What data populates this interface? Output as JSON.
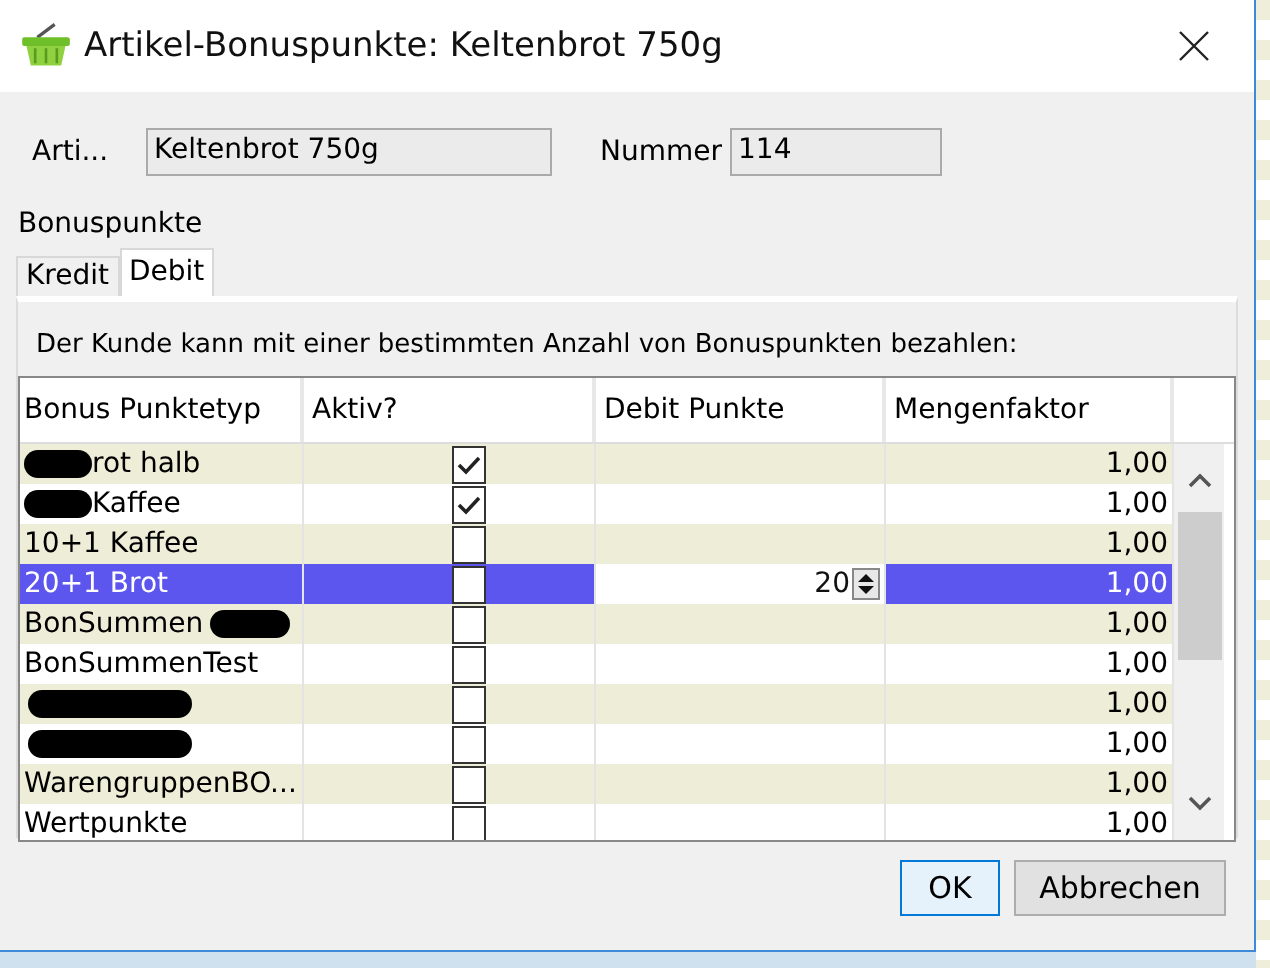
{
  "window": {
    "title": "Artikel-Bonuspunkte: Keltenbrot 750g"
  },
  "article": {
    "label": "Arti...",
    "value": "Keltenbrot 750g"
  },
  "number": {
    "label": "Nummer",
    "value": "114"
  },
  "group": {
    "title": "Bonuspunkte"
  },
  "tabs": [
    {
      "label": "Kredit",
      "selected": false
    },
    {
      "label": "Debit",
      "selected": true
    }
  ],
  "hint": "Der Kunde kann mit einer bestimmten Anzahl von Bonuspunkten bezahlen:",
  "table": {
    "columns": [
      "Bonus Punktetyp",
      "Aktiv?",
      "Debit Punkte",
      "Mengenfaktor"
    ],
    "rows": [
      {
        "name": "rot halb",
        "kind": "masked",
        "active": true,
        "factor": "1,00",
        "selected": false
      },
      {
        "name": "Kaffee",
        "kind": "masked",
        "active": true,
        "factor": "1,00",
        "selected": false
      },
      {
        "name": "10+1 Kaffee",
        "kind": "plain",
        "active": false,
        "factor": "1,00",
        "selected": false
      },
      {
        "name": "20+1 Brot",
        "kind": "plain",
        "active": false,
        "debit": "20",
        "factor": "1,00",
        "selected": true
      },
      {
        "name": "BonSummen",
        "kind": "maskedtail",
        "active": false,
        "factor": "1,00",
        "selected": false
      },
      {
        "name": "BonSummenTest",
        "kind": "plain",
        "active": false,
        "factor": "1,00",
        "selected": false
      },
      {
        "kind": "hidden",
        "active": false,
        "factor": "1,00",
        "selected": false
      },
      {
        "kind": "hidden",
        "active": false,
        "factor": "1,00",
        "selected": false
      },
      {
        "name": "WarengruppenBO...",
        "kind": "plain",
        "active": false,
        "factor": "1,00",
        "selected": false
      },
      {
        "name": "Wertpunkte",
        "kind": "plain",
        "active": false,
        "factor": "1,00",
        "selected": false
      }
    ]
  },
  "buttons": [
    {
      "label": "OK",
      "default": true
    },
    {
      "label": "Abbrechen",
      "default": false
    }
  ]
}
